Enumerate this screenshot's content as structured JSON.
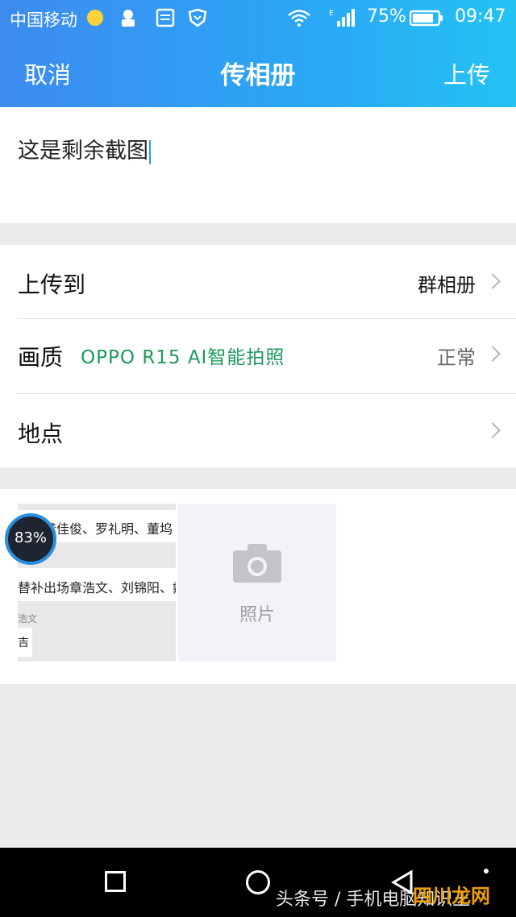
{
  "status_bar": {
    "carrier": "中国移动",
    "battery": "75%",
    "time": "09:47"
  },
  "nav": {
    "cancel": "取消",
    "title": "传相册",
    "upload": "上传"
  },
  "caption": {
    "text": "这是剩余截图"
  },
  "options": {
    "upload_to": {
      "label": "上传到",
      "value": "群相册"
    },
    "quality": {
      "label": "画质",
      "overlay": "OPPO R15  AI智能拍照",
      "value": "正常"
    },
    "location": {
      "label": "地点"
    }
  },
  "photos": {
    "thumb_lines": [
      "发大龚佳俊、罗礼明、董坞",
      "替补出场章浩文、刘锦阳、戴"
    ],
    "thumb_small": "浩文",
    "thumb_tag": "吉",
    "gauge": "83%",
    "add_label": "照片"
  },
  "watermark": {
    "text": "头条号 / 手机电脑知识王",
    "site": "四川龙网"
  },
  "colors": {
    "header_start": "#3d8bf0",
    "header_end": "#24c3f4",
    "accent": "#2a9df4",
    "overlay_green": "#1b9a5b"
  }
}
